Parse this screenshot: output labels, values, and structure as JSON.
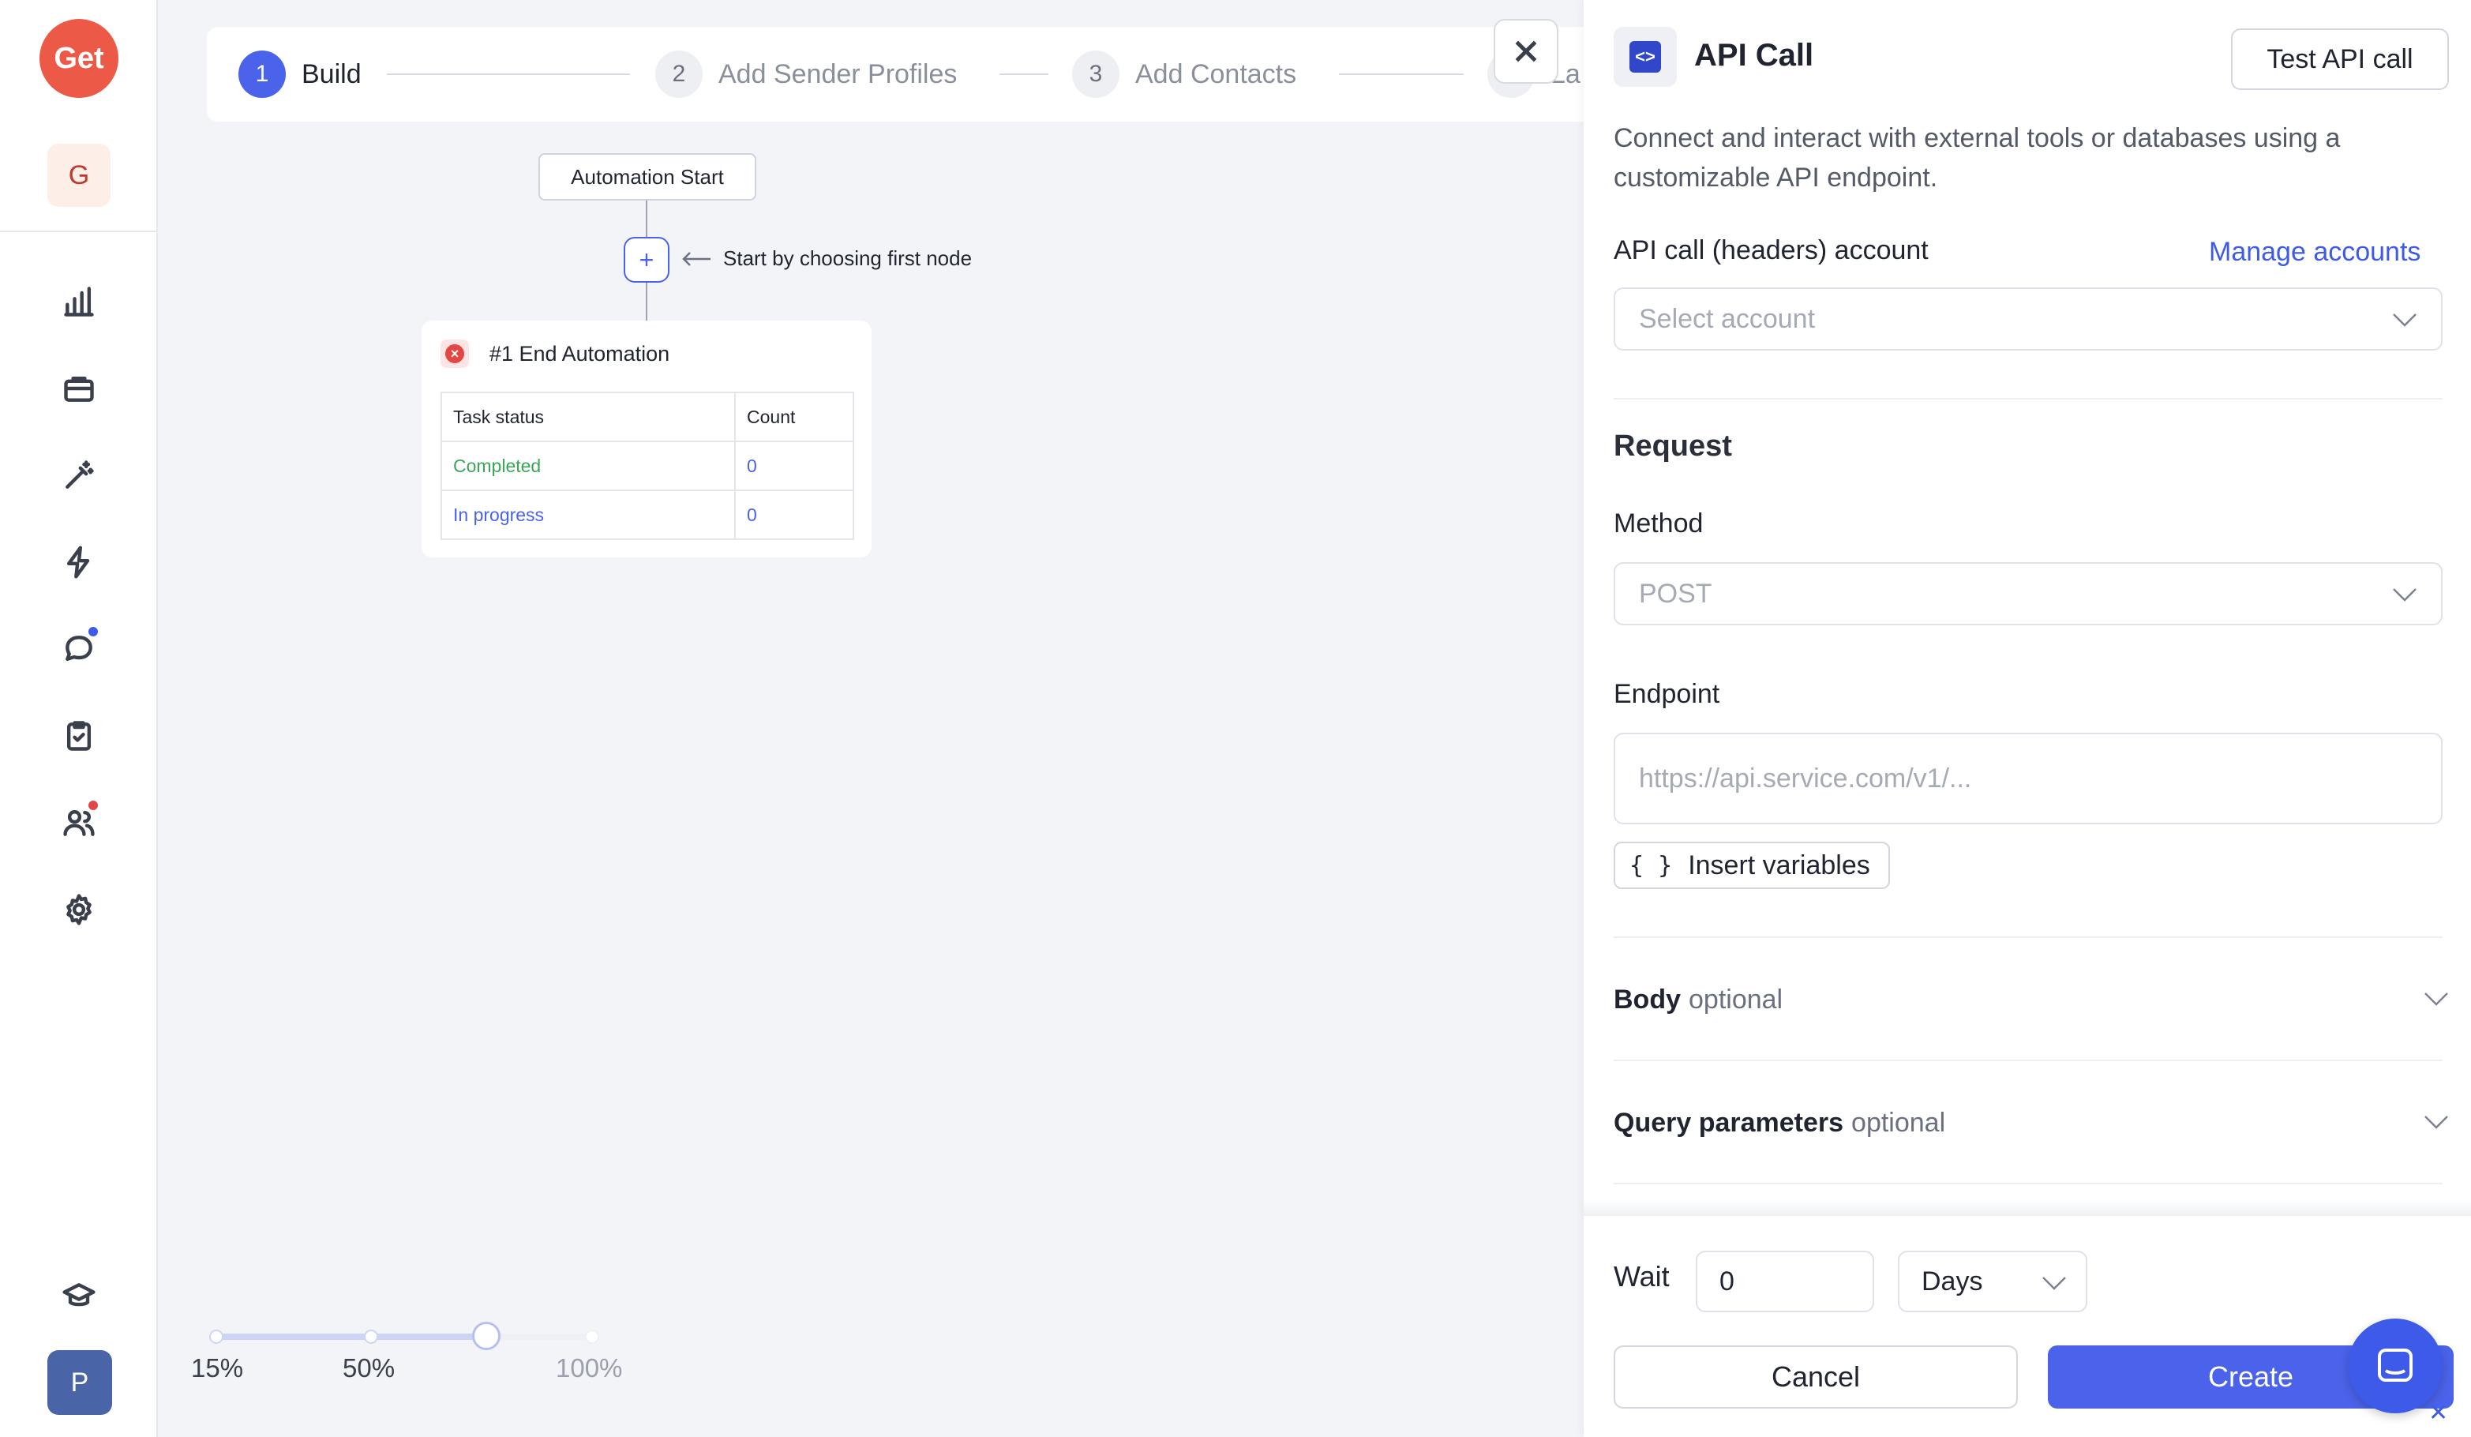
{
  "sidebar": {
    "logo_text": "Get",
    "workspace_initial": "G",
    "user_initial": "P",
    "icons": [
      "analytics-icon",
      "briefcase-icon",
      "magic-wand-icon",
      "lightning-icon",
      "chat-icon",
      "clipboard-icon",
      "users-icon",
      "gear-icon",
      "graduation-cap-icon"
    ],
    "badge_colors": {
      "chat": "#3d5be8",
      "users": "#e44545"
    }
  },
  "stepper": {
    "steps": [
      {
        "num": "1",
        "label": "Build"
      },
      {
        "num": "2",
        "label": "Add Sender Profiles"
      },
      {
        "num": "3",
        "label": "Add Contacts"
      },
      {
        "num": "",
        "label": "La"
      }
    ]
  },
  "canvas": {
    "start_node_label": "Automation Start",
    "plus_label": "+",
    "hint": "Start by choosing first node",
    "end_node": {
      "title": "#1 End Automation",
      "headers": [
        "Task status",
        "Count"
      ],
      "rows": [
        {
          "status": "Completed",
          "count": "0"
        },
        {
          "status": "In progress",
          "count": "0"
        }
      ]
    },
    "zoom": {
      "labels": [
        "15%",
        "50%",
        "100%"
      ],
      "current_fraction": 0.72
    }
  },
  "panel": {
    "title": "API Call",
    "icon_glyph": "<>",
    "test_button": "Test API call",
    "description": "Connect and interact with external tools or databases using a customizable API endpoint.",
    "account_label": "API call (headers) account",
    "manage_link": "Manage accounts",
    "account_placeholder": "Select account",
    "request_title": "Request",
    "method_label": "Method",
    "method_value": "POST",
    "endpoint_label": "Endpoint",
    "endpoint_placeholder": "https://api.service.com/v1/...",
    "insert_variables_braces": "{ }",
    "insert_variables": "Insert variables",
    "body_label": "Body",
    "body_optional": "optional",
    "query_label": "Query parameters",
    "query_optional": "optional",
    "wait_label": "Wait",
    "wait_value": "0",
    "wait_unit": "Days",
    "cancel": "Cancel",
    "create": "Create",
    "chat_close": "✕"
  },
  "colors": {
    "accent": "#4a63ea",
    "logo": "#ec5a47",
    "completed": "#3aa757",
    "error": "#e44545"
  }
}
